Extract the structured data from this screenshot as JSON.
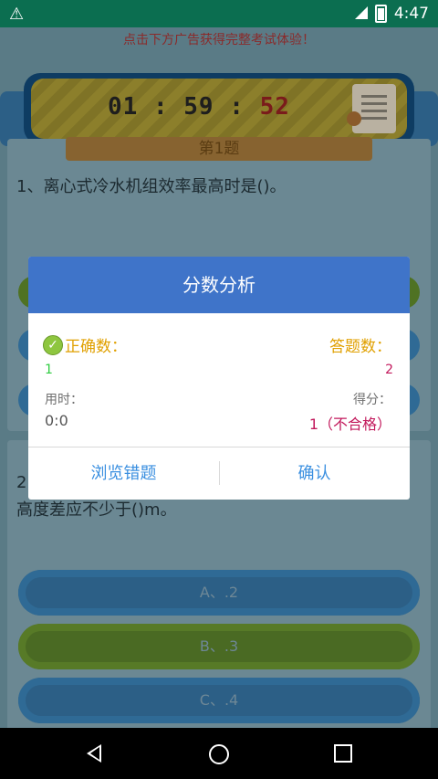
{
  "status_bar": {
    "time": "4:47",
    "warning_symbol": "⚠"
  },
  "app": {
    "ad_hint": "点击下方广告获得完整考试体验！",
    "timer": {
      "hh": "01",
      "mm": "59",
      "ss": "52",
      "sep": " : "
    },
    "question1": {
      "badge": "第1题",
      "text": "1、离心式冷水机组效率最高时是()。"
    },
    "question2": {
      "line1": "2.",
      "line2": "高度差应不少于()m。",
      "options": [
        "A、.2",
        "B、.3",
        "C、.4"
      ]
    }
  },
  "dialog": {
    "title": "分数分析",
    "correct_label": "正确数：",
    "correct_value": "1",
    "answered_label": "答题数：",
    "answered_value": "2",
    "time_label": "用时：",
    "time_value": "0:0",
    "score_label": "得分：",
    "score_value": "1（不合格）",
    "review_button": "浏览错题",
    "confirm_button": "确认"
  },
  "colors": {
    "dialog_header": "#3f74c9",
    "button_text": "#3a8fe0",
    "label_orange": "#e0a000",
    "correct_green": "#2ecc40",
    "score_red": "#c2185b"
  }
}
